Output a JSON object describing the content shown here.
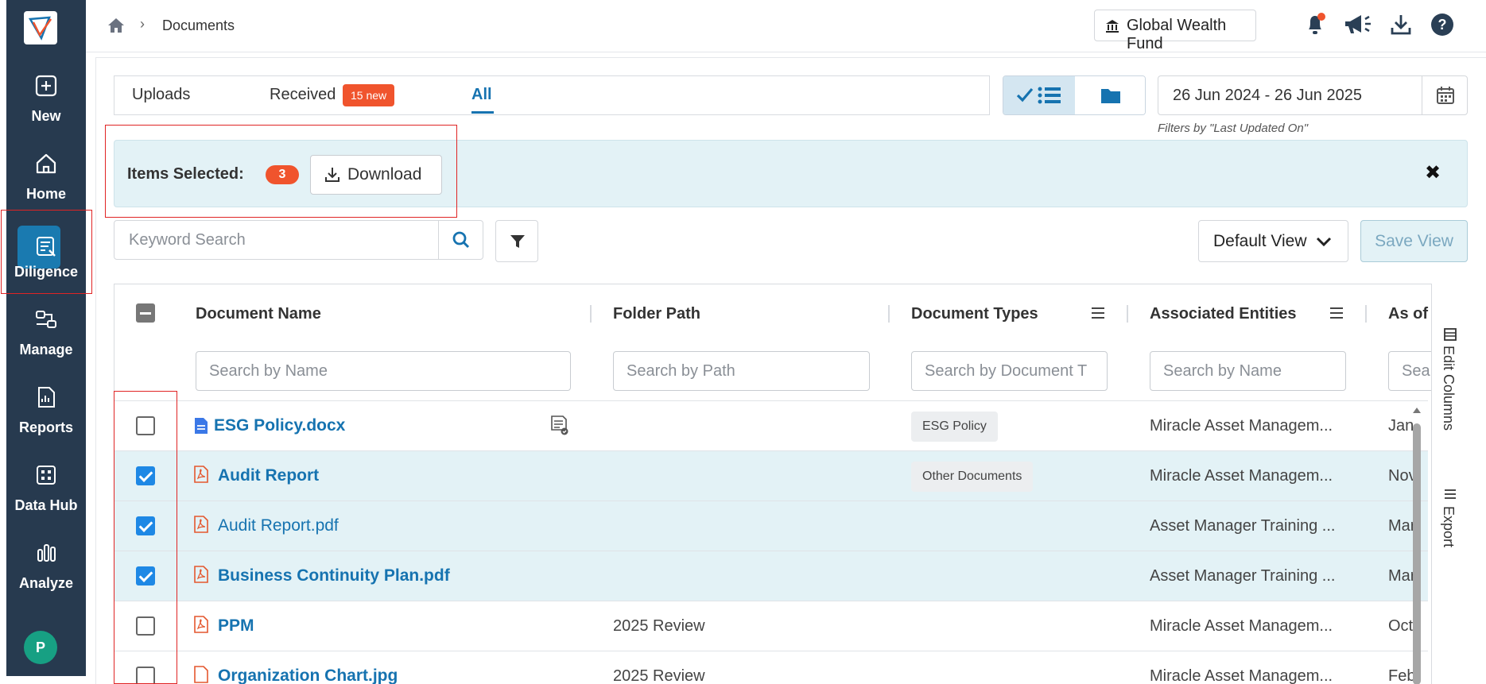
{
  "breadcrumb": {
    "current": "Documents"
  },
  "header": {
    "fund_name": "Global Wealth Fund"
  },
  "sidebar": {
    "items": [
      {
        "label": "New",
        "icon": "plus-square-icon"
      },
      {
        "label": "Home",
        "icon": "home-icon"
      },
      {
        "label": "Diligence",
        "icon": "diligence-icon",
        "active": true
      },
      {
        "label": "Manage",
        "icon": "manage-icon"
      },
      {
        "label": "Reports",
        "icon": "reports-icon"
      },
      {
        "label": "Data Hub",
        "icon": "data-hub-icon"
      },
      {
        "label": "Analyze",
        "icon": "bar-chart-icon"
      }
    ],
    "avatar_initial": "P"
  },
  "tabs": {
    "uploads": "Uploads",
    "received": "Received",
    "received_badge": "15 new",
    "all": "All"
  },
  "date_filter": {
    "value": "26 Jun 2024 - 26 Jun 2025",
    "note": "Filters by \"Last Updated On\""
  },
  "selection": {
    "label": "Items Selected:",
    "count": "3",
    "download_label": "Download",
    "close_symbol": "✖"
  },
  "search": {
    "placeholder": "Keyword Search"
  },
  "view": {
    "selected": "Default View",
    "save_label": "Save View"
  },
  "table": {
    "columns": {
      "name": "Document Name",
      "folder": "Folder Path",
      "types": "Document Types",
      "entities": "Associated Entities",
      "asof": "As of"
    },
    "filters": {
      "name": "Search by Name",
      "folder": "Search by Path",
      "types": "Search by Document T",
      "entities": "Search by Name",
      "asof": "Sea"
    },
    "rows": [
      {
        "name": "ESG Policy.docx",
        "bold": true,
        "checked": false,
        "folder": "",
        "type": "ESG Policy",
        "entity": "Miracle Asset Managem...",
        "asof": "Jan",
        "icon": "word-doc-icon"
      },
      {
        "name": "Audit Report",
        "bold": true,
        "checked": true,
        "folder": "",
        "type": "Other Documents",
        "entity": "Miracle Asset Managem...",
        "asof": "Nov",
        "icon": "pdf-icon"
      },
      {
        "name": "Audit Report.pdf",
        "bold": false,
        "checked": true,
        "folder": "",
        "type": "",
        "entity": "Asset Manager Training ...",
        "asof": "Mar",
        "icon": "pdf-icon"
      },
      {
        "name": "Business Continuity Plan.pdf",
        "bold": true,
        "checked": true,
        "folder": "",
        "type": "",
        "entity": "Asset Manager Training ...",
        "asof": "Mar",
        "icon": "pdf-icon"
      },
      {
        "name": "PPM",
        "bold": true,
        "checked": false,
        "folder": "2025 Review",
        "type": "",
        "entity": "Miracle Asset Managem...",
        "asof": "Oct",
        "icon": "pdf-icon"
      },
      {
        "name": "Organization Chart.jpg",
        "bold": true,
        "checked": false,
        "folder": "2025 Review",
        "type": "",
        "entity": "Miracle Asset Managem...",
        "asof": "Feb",
        "icon": "pdf-icon"
      }
    ]
  },
  "side_tools": {
    "edit_columns": "Edit Columns",
    "export": "Export"
  },
  "colors": {
    "sidebar": "#273a4f",
    "accent": "#1673b0",
    "badge": "#f0542d",
    "selection_bg": "#e3f2f6"
  }
}
